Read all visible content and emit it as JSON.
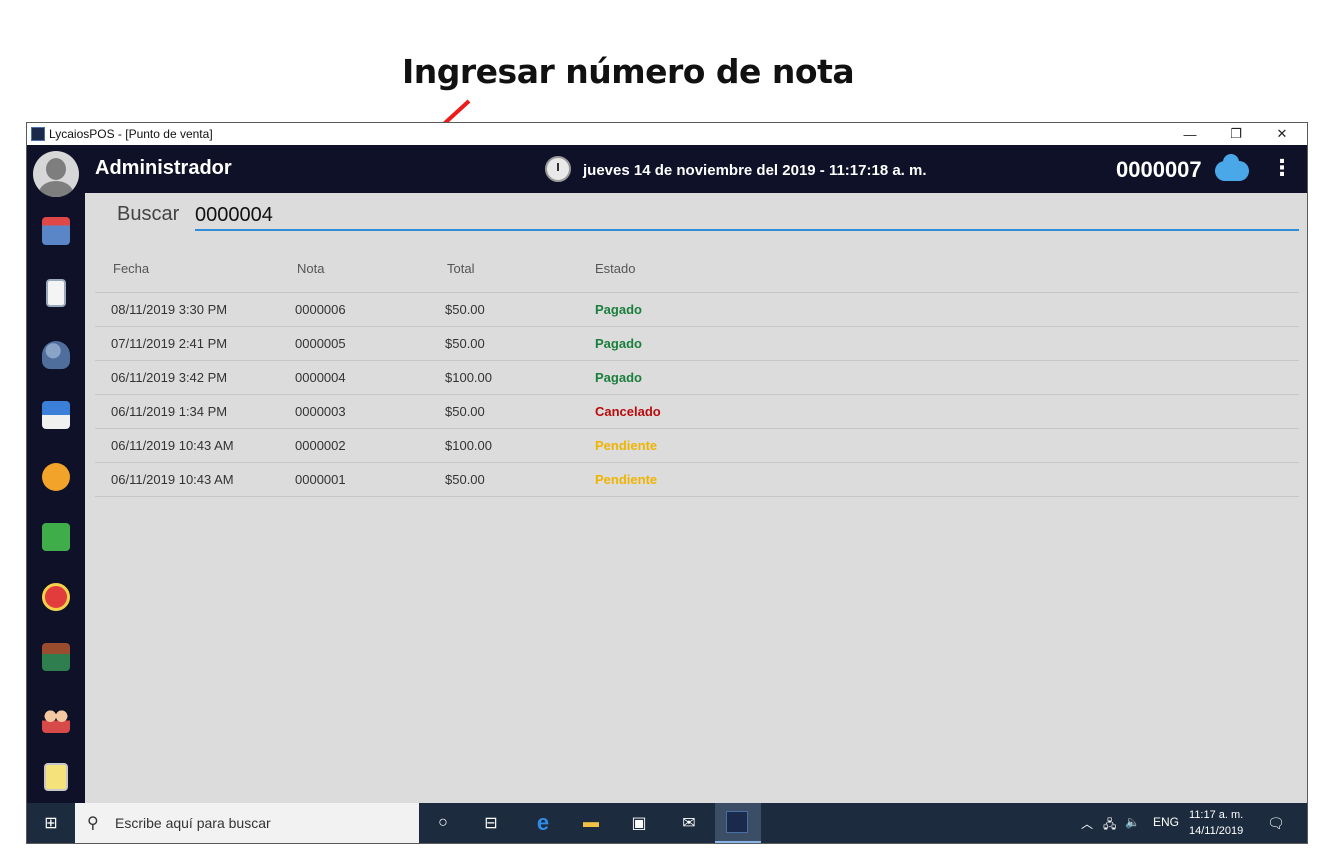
{
  "annotation": {
    "title": "Ingresar número de nota"
  },
  "window": {
    "title": "LycaiosPOS - [Punto de venta]",
    "controls": {
      "minimize": "—",
      "restore": "❐",
      "close": "✕"
    }
  },
  "appbar": {
    "user": "Administrador",
    "datetime": "jueves 14 de noviembre del 2019 - 11:17:18 a. m.",
    "note_number": "0000007",
    "menu_glyph": "⋮"
  },
  "sidebar": {
    "icons": [
      "cart-icon",
      "receipt-icon",
      "users-icon",
      "schedule-report-icon",
      "top-badge-icon",
      "money-icon",
      "timer-icon",
      "warehouse-icon",
      "team-icon",
      "phone-card-icon"
    ]
  },
  "search": {
    "label": "Buscar",
    "value": "0000004"
  },
  "table": {
    "headers": {
      "fecha": "Fecha",
      "nota": "Nota",
      "total": "Total",
      "estado": "Estado"
    },
    "rows": [
      {
        "fecha": "08/11/2019 3:30 PM",
        "nota": "0000006",
        "total": "$50.00",
        "estado": "Pagado"
      },
      {
        "fecha": "07/11/2019 2:41 PM",
        "nota": "0000005",
        "total": "$50.00",
        "estado": "Pagado"
      },
      {
        "fecha": "06/11/2019 3:42 PM",
        "nota": "0000004",
        "total": "$100.00",
        "estado": "Pagado"
      },
      {
        "fecha": "06/11/2019 1:34 PM",
        "nota": "0000003",
        "total": "$50.00",
        "estado": "Cancelado"
      },
      {
        "fecha": "06/11/2019 10:43 AM",
        "nota": "0000002",
        "total": "$100.00",
        "estado": "Pendiente"
      },
      {
        "fecha": "06/11/2019 10:43 AM",
        "nota": "0000001",
        "total": "$50.00",
        "estado": "Pendiente"
      }
    ],
    "status_colors": {
      "Pagado": "#1a7f3c",
      "Cancelado": "#b80c0c",
      "Pendiente": "#f0b400"
    }
  },
  "taskbar": {
    "search_placeholder": "Escribe aquí para buscar",
    "language": "ENG",
    "time": "11:17 a. m.",
    "date": "14/11/2019"
  }
}
